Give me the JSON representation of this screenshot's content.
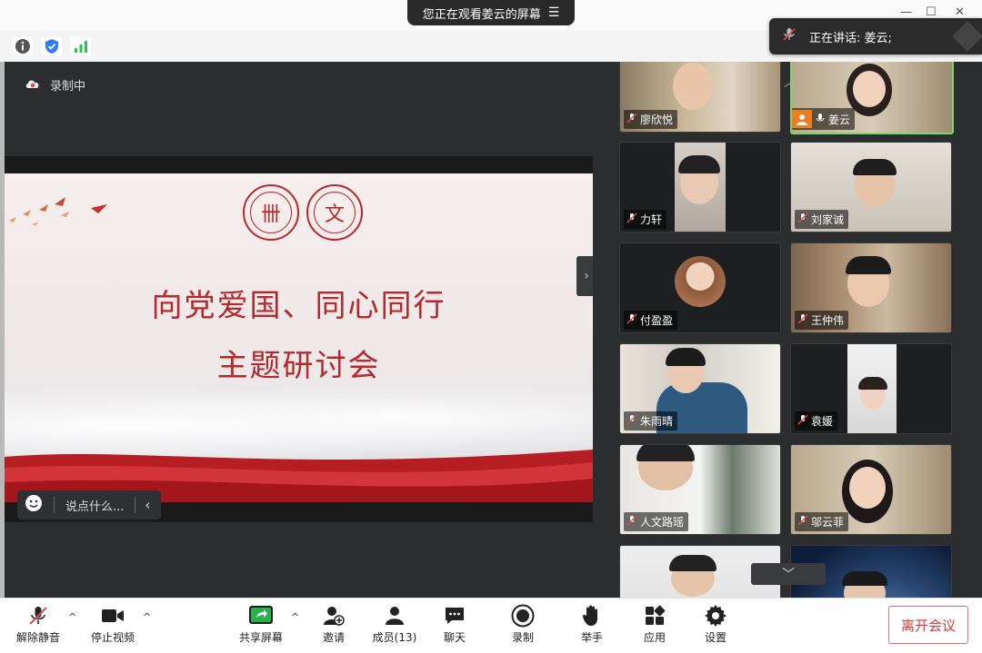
{
  "window": {
    "viewing_banner": "您正在观看姜云的屏幕",
    "speaking_label": "正在讲话: 姜云;"
  },
  "recording": {
    "label": "录制中"
  },
  "slide": {
    "title_line1": "向党爱国、同心同行",
    "title_line2": "主题研讨会"
  },
  "chat": {
    "placeholder": "说点什么..."
  },
  "participants": [
    {
      "name": "廖欣悦",
      "muted": true
    },
    {
      "name": "姜云",
      "muted": false,
      "active": true
    },
    {
      "name": "力轩",
      "muted": true
    },
    {
      "name": "刘家诚",
      "muted": true
    },
    {
      "name": "付盈盈",
      "muted": true
    },
    {
      "name": "王仲伟",
      "muted": true
    },
    {
      "name": "朱雨晴",
      "muted": true
    },
    {
      "name": "袁媛",
      "muted": true
    },
    {
      "name": "人文路瑶",
      "muted": true
    },
    {
      "name": "邬云菲",
      "muted": true
    }
  ],
  "toolbar": {
    "unmute": "解除静音",
    "stop_video": "停止视频",
    "share_screen": "共享屏幕",
    "invite": "邀请",
    "members": "成员(13)",
    "chat": "聊天",
    "record": "录制",
    "raise_hand": "举手",
    "apps": "应用",
    "settings": "设置",
    "leave": "离开会议"
  },
  "colors": {
    "accent_green": "#7fd66b",
    "slide_red": "#b8282a",
    "leave_red": "#d83a3a"
  }
}
